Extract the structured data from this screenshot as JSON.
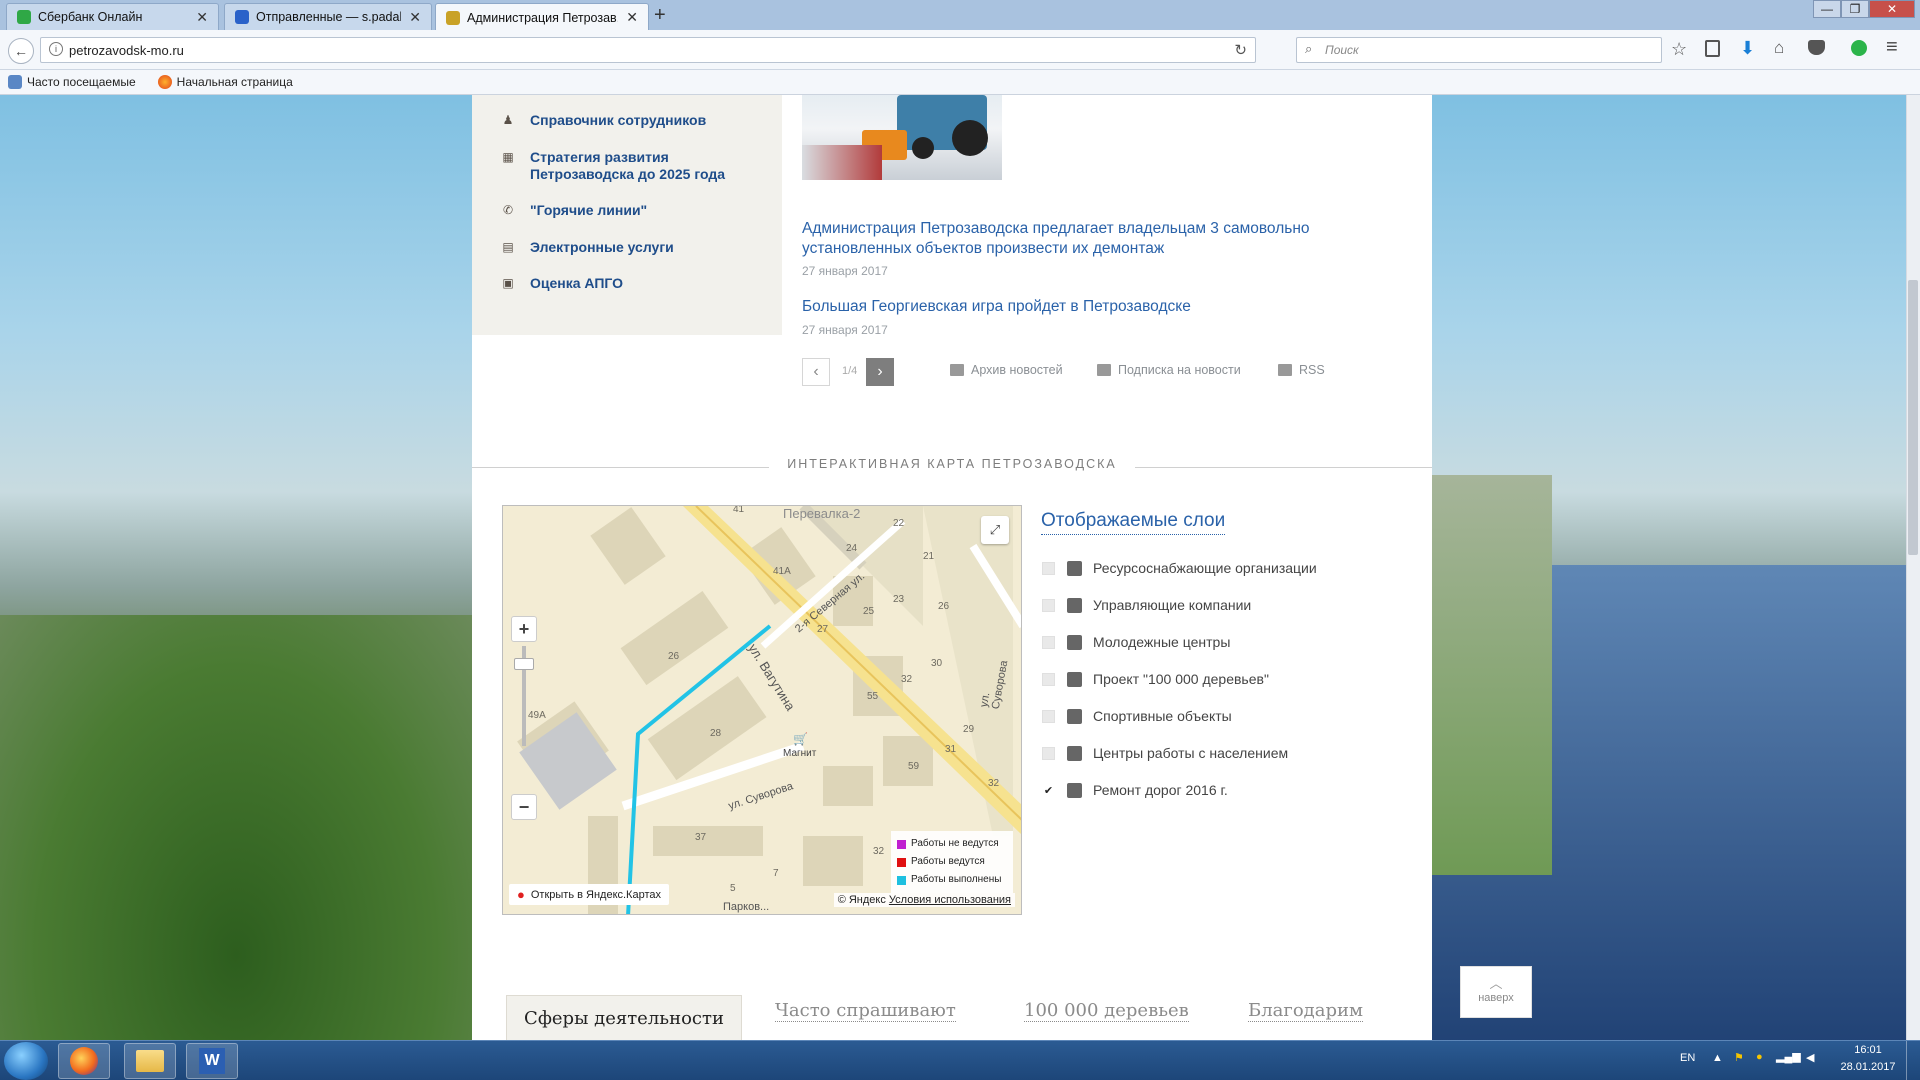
{
  "browser": {
    "tabs": [
      {
        "title": "Сбербанк Онлайн",
        "favicon_color": "#2fa846"
      },
      {
        "title": "Отправленные — s.padalk...",
        "favicon_color": "#2a62c9"
      },
      {
        "title": "Администрация Петрозав...",
        "favicon_color": "#c9a227"
      }
    ],
    "new_tab_glyph": "+",
    "url": "petrozavodsk-mo.ru",
    "search_placeholder": "Поиск",
    "bookmarks": [
      {
        "label": "Часто посещаемые",
        "icon": "bookmark-folder-icon"
      },
      {
        "label": "Начальная страница",
        "icon": "firefox-icon"
      }
    ]
  },
  "left_menu": [
    {
      "label": "Справочник сотрудников",
      "icon": "people-icon"
    },
    {
      "label": "Стратегия развития Петрозаводска до 2025 года",
      "icon": "strategy-icon"
    },
    {
      "label": "\"Горячие линии\"",
      "icon": "phone-icon"
    },
    {
      "label": "Электронные услуги",
      "icon": "services-icon"
    },
    {
      "label": "Оценка АПГО",
      "icon": "rating-icon"
    }
  ],
  "news": {
    "items": [
      {
        "title": "Администрация Петрозаводска предлагает владельцам 3 самовольно установленных объектов произвести их демонтаж",
        "date": "27 января 2017"
      },
      {
        "title": "Большая Георгиевская игра пройдет в Петрозаводске",
        "date": "27 января 2017"
      }
    ],
    "pager": "1/4",
    "archive_label": "Архив новостей",
    "subscribe_label": "Подписка на новости",
    "rss_label": "RSS"
  },
  "map_section": {
    "title": "ИНТЕРАКТИВНАЯ КАРТА ПЕТРОЗАВОДСКА",
    "streets": [
      "ул. Вагутина",
      "2-я Северная ул.",
      "ул. Суворова",
      "ул. Суворова",
      "Перевалка-2",
      "Парков..."
    ],
    "houses": [
      "41",
      "41А",
      "24",
      "22",
      "21",
      "23",
      "26",
      "25",
      "27",
      "26",
      "30",
      "32",
      "55",
      "29",
      "28",
      "31",
      "59",
      "32",
      "49А",
      "37",
      "32",
      "5",
      "7"
    ],
    "poi": "Магнит",
    "legend": [
      {
        "label": "Работы не ведутся",
        "color": "#c020d0"
      },
      {
        "label": "Работы ведутся",
        "color": "#e01010"
      },
      {
        "label": "Работы выполнены",
        "color": "#1ec0e0"
      }
    ],
    "open_in_yandex": "Открыть в Яндекс.Картах",
    "copyright": "© Яндекс",
    "terms": "Условия использования",
    "zoom_in": "+",
    "zoom_out": "−"
  },
  "layers": {
    "title": "Отображаемые слои",
    "items": [
      {
        "label": "Ресурсоснабжающие организации",
        "checked": false
      },
      {
        "label": "Управляющие компании",
        "checked": false
      },
      {
        "label": "Молодежные центры",
        "checked": false
      },
      {
        "label": "Проект \"100 000 деревьев\"",
        "checked": false
      },
      {
        "label": "Спортивные объекты",
        "checked": false
      },
      {
        "label": "Центры работы с населением",
        "checked": false
      },
      {
        "label": "Ремонт дорог 2016 г.",
        "checked": true
      }
    ],
    "check_glyph": "✔"
  },
  "bottom_tabs": [
    "Сферы деятельности",
    "Часто спрашивают",
    "100 000 деревьев",
    "Благодарим"
  ],
  "to_top_label": "наверх",
  "taskbar": {
    "lang": "EN",
    "time": "16:01",
    "date": "28.01.2017"
  }
}
